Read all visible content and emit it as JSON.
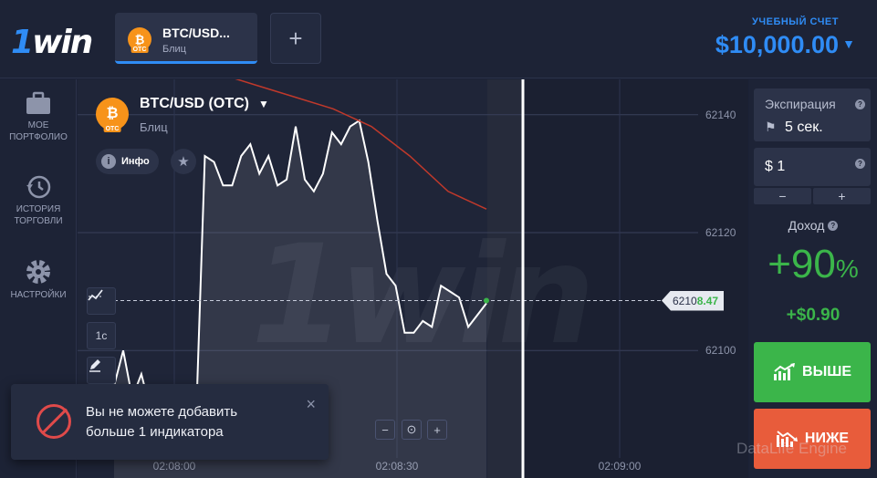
{
  "header": {
    "logo": "1win",
    "asset_tab": {
      "name": "BTC/USD...",
      "sub": "Блиц",
      "coin_badge": "OTC"
    },
    "add_tab_label": "+",
    "account_label": "УЧЕБНЫЙ СЧЕТ",
    "balance": "$10,000.00"
  },
  "sidebar": {
    "items": [
      {
        "label": "МОЕ ПОРТФОЛИО",
        "icon": "briefcase-icon"
      },
      {
        "label": "ИСТОРИЯ ТОРГОВЛИ",
        "icon": "history-icon"
      },
      {
        "label": "НАСТРОЙКИ",
        "icon": "gear-icon"
      }
    ]
  },
  "chart": {
    "asset_title": "BTC/USD (OTC)",
    "asset_subtitle": "Блиц",
    "coin_badge": "OTC",
    "info_label": "Инфо",
    "timeframe": "1с",
    "price_tag_main": "6210",
    "price_tag_hi": "8.47",
    "watermark": "1win",
    "zoom": {
      "minus": "−",
      "center": "⊙",
      "plus": "+"
    }
  },
  "chart_data": {
    "type": "line",
    "y_ticks": [
      62140,
      62120,
      62100
    ],
    "y_tick_labels": [
      "62140",
      "62120",
      "62100"
    ],
    "x_tick_labels": [
      "02:08:00",
      "02:08:30",
      "02:09:00"
    ],
    "ylim": [
      62081,
      62146
    ],
    "current_price": 62108.47,
    "series": [
      {
        "values": [
          62094,
          62100,
          62092,
          62096,
          62090,
          62083,
          62088,
          62086,
          62089,
          62087,
          62133,
          62132,
          62128,
          62128,
          62133,
          62135,
          62130,
          62133,
          62128,
          62129,
          62138,
          62129,
          62127,
          62130,
          62137,
          62135,
          62138,
          62139,
          62132,
          62122,
          62113,
          62111,
          62103,
          62103,
          62105,
          62104,
          62111,
          62110,
          62109,
          62104,
          62106,
          62108
        ]
      },
      {
        "values": [
          62151,
          62149,
          62147,
          62145,
          62143,
          62141,
          62138,
          62133,
          62127,
          62124
        ]
      }
    ]
  },
  "toast": {
    "message": "Вы не можете добавить больше 1 индикатора",
    "close": "×"
  },
  "panel": {
    "expiry_label": "Экспирация",
    "expiry_value": "5 сек.",
    "amount_value": "$ 1",
    "minus": "−",
    "plus": "+",
    "profit_label": "Доход",
    "profit_pct": "+90",
    "profit_pct_sign": "%",
    "profit_amount": "+$0.90",
    "up_label": "ВЫШЕ",
    "down_label": "НИЖЕ"
  },
  "watermark_text": "DataLife Engine",
  "colors": {
    "accent": "#2f8cf5",
    "up": "#3bb54a",
    "down": "#e85c3b",
    "ma": "#c0392b"
  }
}
